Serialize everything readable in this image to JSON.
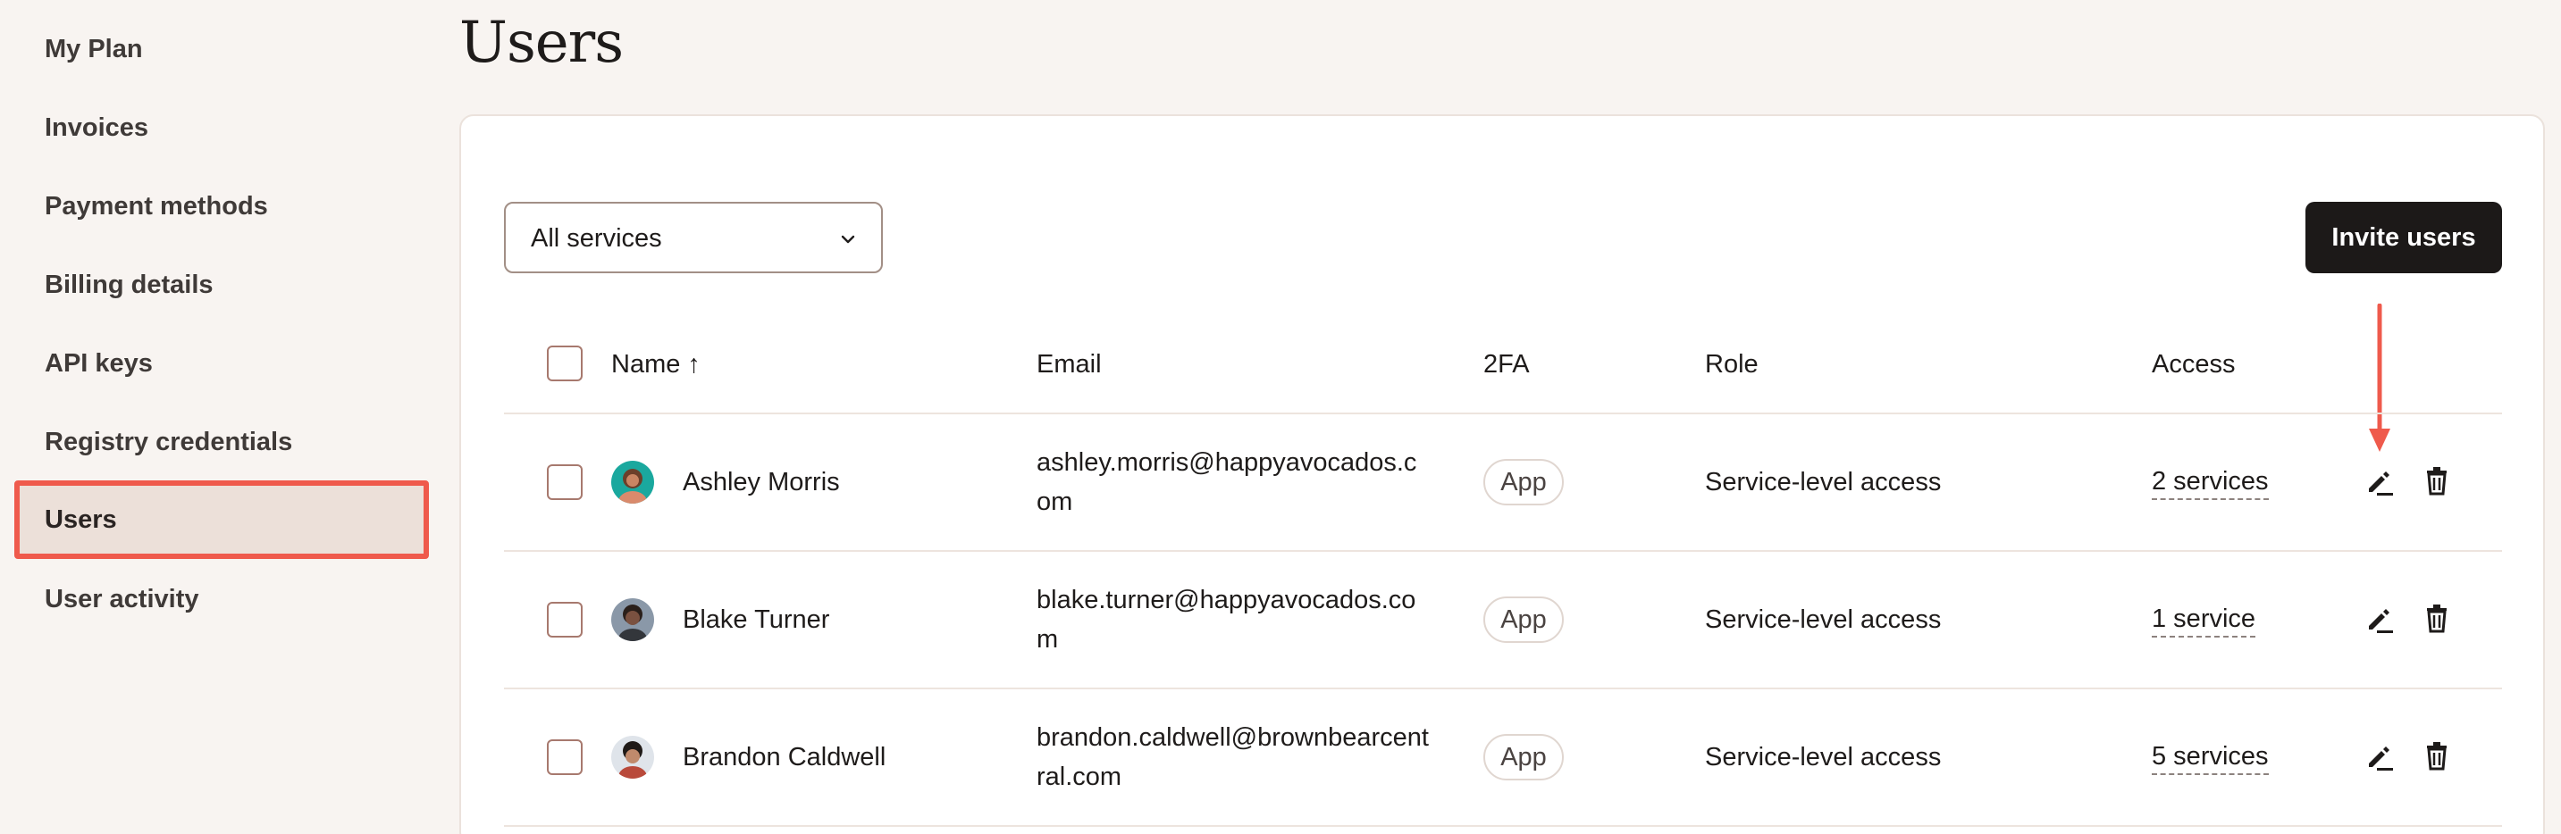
{
  "sidebar": {
    "items": [
      {
        "label": "My Plan"
      },
      {
        "label": "Invoices"
      },
      {
        "label": "Payment methods"
      },
      {
        "label": "Billing details"
      },
      {
        "label": "API keys"
      },
      {
        "label": "Registry credentials"
      },
      {
        "label": "Users"
      },
      {
        "label": "User activity"
      }
    ],
    "active": "Users"
  },
  "page": {
    "title": "Users"
  },
  "filter": {
    "selected": "All services"
  },
  "invite": {
    "label": "Invite users"
  },
  "table": {
    "headers": {
      "name": "Name ↑",
      "email": "Email",
      "twofa": "2FA",
      "role": "Role",
      "access": "Access"
    },
    "rows": [
      {
        "name": "Ashley Morris",
        "email": "ashley.morris@happyavocados.com",
        "twofa": "App",
        "role": "Service-level access",
        "access": "2 services"
      },
      {
        "name": "Blake Turner",
        "email": "blake.turner@happyavocados.com",
        "twofa": "App",
        "role": "Service-level access",
        "access": "1 service"
      },
      {
        "name": "Brandon Caldwell",
        "email": "brandon.caldwell@brownbearcentral.com",
        "twofa": "App",
        "role": "Service-level access",
        "access": "5 services"
      }
    ]
  },
  "colors": {
    "highlight": "#ef5a4c",
    "primary_button": "#1c1918",
    "page_bg": "#f8f4f1"
  }
}
